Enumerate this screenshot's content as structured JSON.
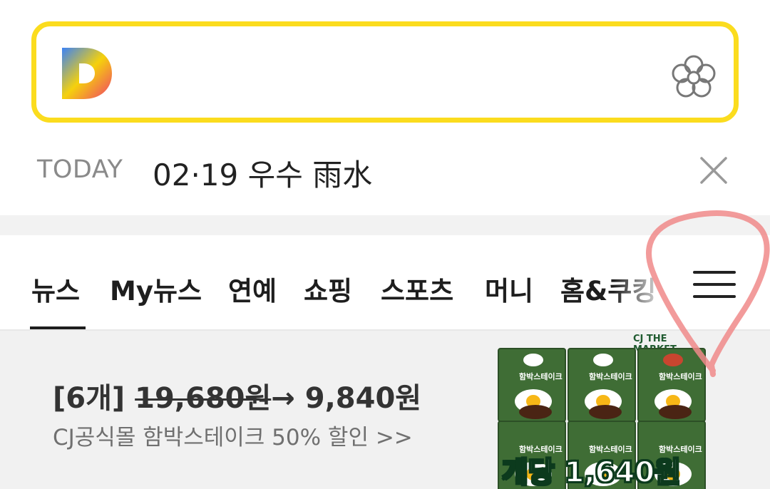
{
  "search": {
    "value": "",
    "placeholder": ""
  },
  "logo": {
    "icon": "daum-logo-icon"
  },
  "flower": {
    "icon": "flower-icon"
  },
  "today": {
    "label": "TODAY",
    "text": "02·19 우수 雨水"
  },
  "tabs": [
    {
      "label": "뉴스",
      "selected": true
    },
    {
      "label": "My뉴스"
    },
    {
      "label": "연예"
    },
    {
      "label": "쇼핑"
    },
    {
      "label": "스포츠"
    },
    {
      "label": "머니"
    },
    {
      "label": "홈&쿠킹"
    }
  ],
  "menu": {
    "icon": "hamburger-menu-icon"
  },
  "ad": {
    "count": "[6개]",
    "old_price": "19,680원",
    "arrow": "→",
    "new_price": "9,840원",
    "subtitle": "CJ공식몰 함박스테이크 50% 할인 >>",
    "product_brand": "CJ THE MARKET",
    "product_label": "함박스테이크",
    "product_tag": "개당 1,640원"
  },
  "colors": {
    "search_border": "#fbdc1e",
    "annotation": "#f08a8a",
    "background_gap": "#f2f2f2"
  }
}
